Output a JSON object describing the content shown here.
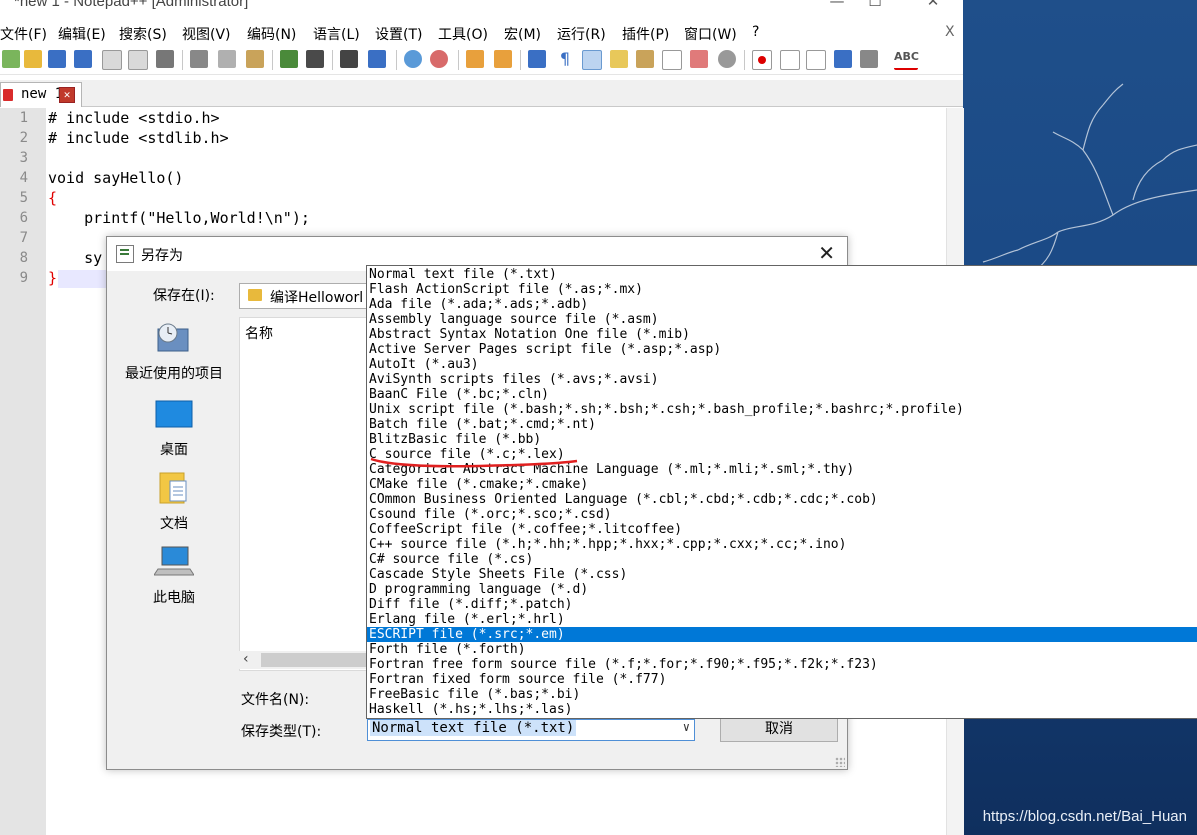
{
  "window": {
    "title": "*new 1 - Notepad++ [Administrator]",
    "minimize": "—",
    "maximize": "☐",
    "close": "✕"
  },
  "menu": [
    "文件(F)",
    "编辑(E)",
    "搜索(S)",
    "视图(V)",
    "编码(N)",
    "语言(L)",
    "设置(T)",
    "工具(O)",
    "宏(M)",
    "运行(R)",
    "插件(P)",
    "窗口(W)",
    "?"
  ],
  "menu_close": "X",
  "tab": {
    "label": "new 1",
    "close": "✕"
  },
  "editor": {
    "line_numbers": [
      "1",
      "2",
      "3",
      "4",
      "5",
      "6",
      "7",
      "8",
      "9"
    ],
    "lines": [
      "# include <stdio.h>",
      "# include <stdlib.h>",
      "",
      "void sayHello()",
      "{",
      "    printf(\"Hello,World!\\n\");",
      "",
      "    sy",
      "}"
    ]
  },
  "dialog": {
    "title": "另存为",
    "close": "✕",
    "save_in_label": "保存在(I):",
    "save_in_value": "编译Helloworl",
    "places": [
      "最近使用的项目",
      "桌面",
      "文档",
      "此电脑"
    ],
    "list_header": "名称",
    "filename_label": "文件名(N):",
    "filetype_label": "保存类型(T):",
    "filetype_value": "Normal text file (*.txt)",
    "cancel_button": "取消"
  },
  "filetype_options": [
    "Normal text file (*.txt)",
    "Flash ActionScript file (*.as;*.mx)",
    "Ada file (*.ada;*.ads;*.adb)",
    "Assembly language source file (*.asm)",
    "Abstract Syntax Notation One file (*.mib)",
    "Active Server Pages script file (*.asp;*.asp)",
    "AutoIt (*.au3)",
    "AviSynth scripts files (*.avs;*.avsi)",
    "BaanC File (*.bc;*.cln)",
    "Unix script file (*.bash;*.sh;*.bsh;*.csh;*.bash_profile;*.bashrc;*.profile)",
    "Batch file (*.bat;*.cmd;*.nt)",
    "BlitzBasic file (*.bb)",
    "C source file (*.c;*.lex)",
    "Categorical Abstract Machine Language (*.ml;*.mli;*.sml;*.thy)",
    "CMake file (*.cmake;*.cmake)",
    "COmmon Business Oriented Language (*.cbl;*.cbd;*.cdb;*.cdc;*.cob)",
    "Csound file (*.orc;*.sco;*.csd)",
    "CoffeeScript file (*.coffee;*.litcoffee)",
    "C++ source file (*.h;*.hh;*.hpp;*.hxx;*.cpp;*.cxx;*.cc;*.ino)",
    "C# source file (*.cs)",
    "Cascade Style Sheets File (*.css)",
    "D programming language (*.d)",
    "Diff file (*.diff;*.patch)",
    "Erlang file (*.erl;*.hrl)",
    "ESCRIPT file (*.src;*.em)",
    "Forth file (*.forth)",
    "Fortran free form source file (*.f;*.for;*.f90;*.f95;*.f2k;*.f23)",
    "Fortran fixed form source file (*.f77)",
    "FreeBasic file (*.bas;*.bi)",
    "Haskell (*.hs;*.lhs;*.las)"
  ],
  "selected_option_index": 24,
  "watermark": "https://blog.csdn.net/Bai_Huan",
  "colors": {
    "selection": "#0078d7",
    "keyword_brace": "#e00000",
    "annotation": "#e00000"
  }
}
